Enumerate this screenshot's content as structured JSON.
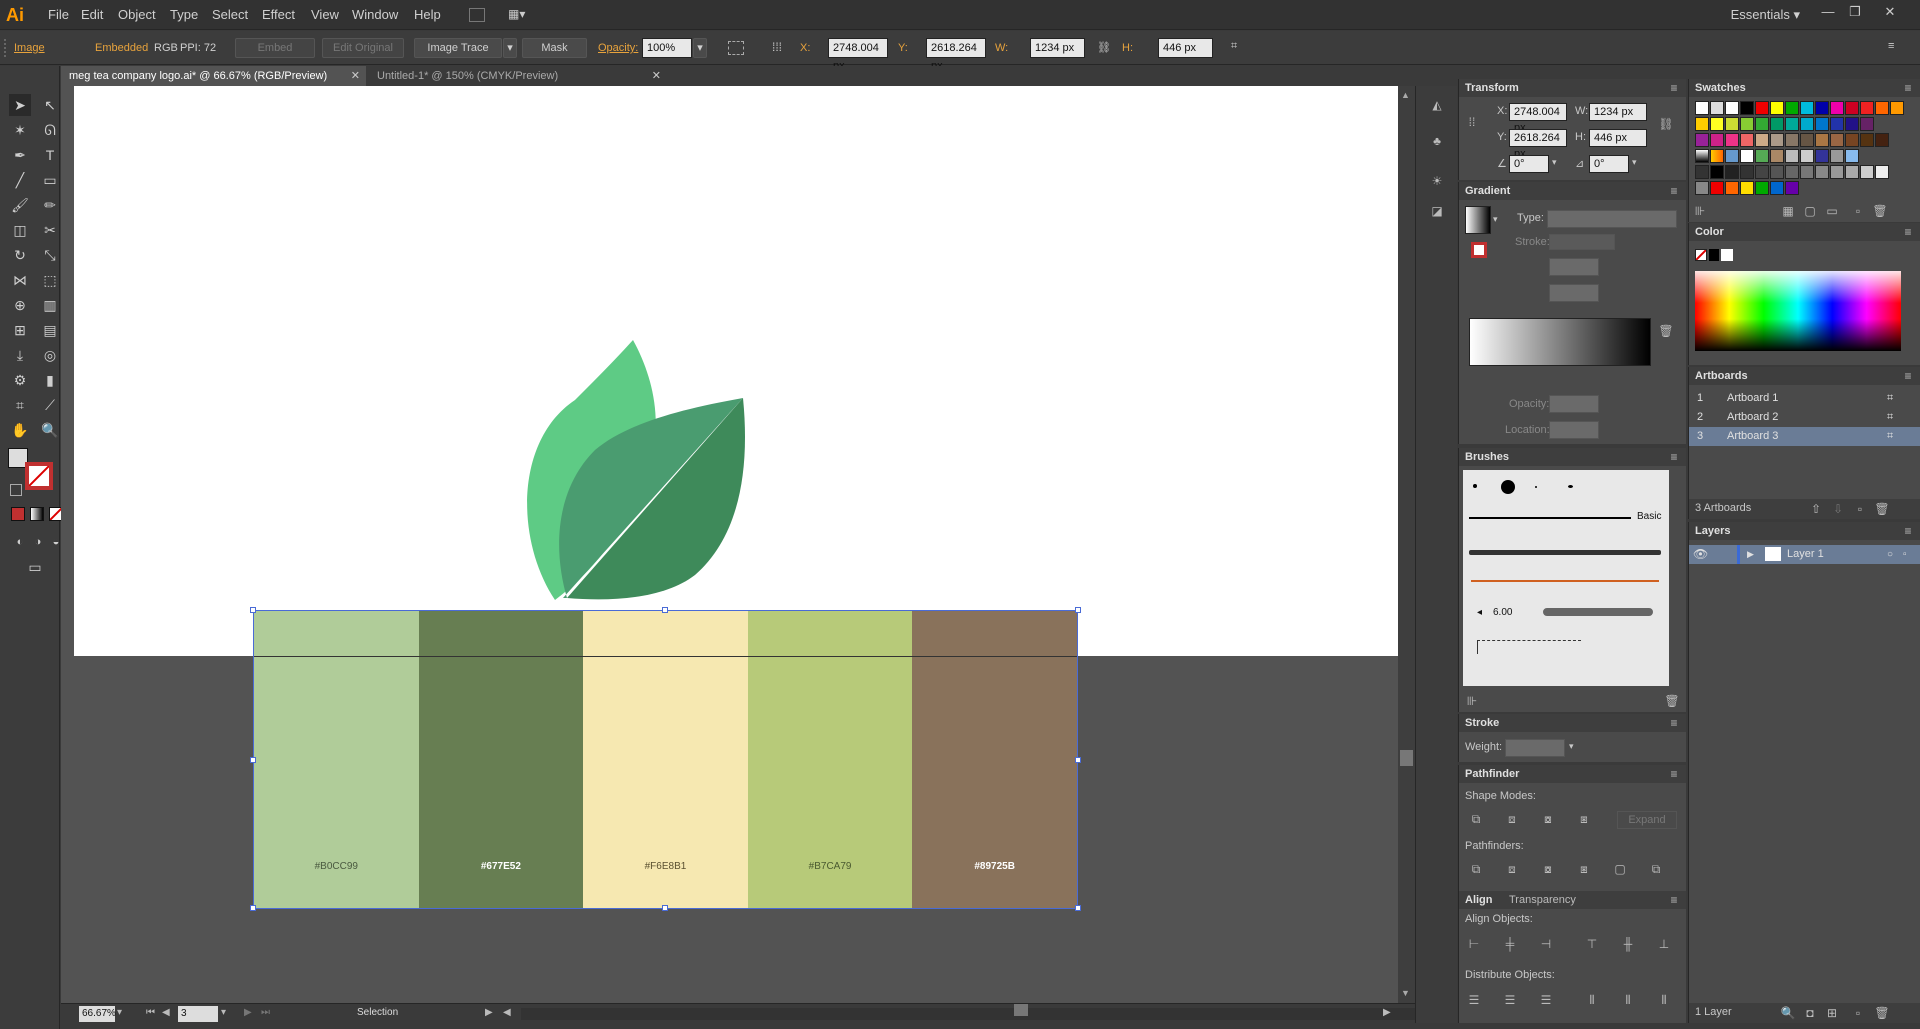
{
  "app": {
    "logo": "Ai",
    "workspace": "Essentials"
  },
  "menu": [
    "File",
    "Edit",
    "Object",
    "Type",
    "Select",
    "Effect",
    "View",
    "Window",
    "Help"
  ],
  "control": {
    "type_label": "Image",
    "embedded_label": "Embedded",
    "color_mode": "RGB",
    "ppi": "PPI: 72",
    "embed_btn": "Embed",
    "edit_original_btn": "Edit Original",
    "image_trace_btn": "Image Trace",
    "mask_btn": "Mask",
    "opacity_label": "Opacity:",
    "opacity_value": "100%",
    "x_label": "X:",
    "x_value": "2748.004 px",
    "y_label": "Y:",
    "y_value": "2618.264 px",
    "w_label": "W:",
    "w_value": "1234 px",
    "h_label": "H:",
    "h_value": "446 px"
  },
  "tabs": [
    {
      "label": "meg tea company logo.ai* @ 66.67% (RGB/Preview)"
    },
    {
      "label": "Untitled-1* @ 150% (CMYK/Preview)"
    }
  ],
  "palette": [
    {
      "hex": "#B0CC99",
      "color": "#B0CC99",
      "label": "#B0CC99",
      "text_color": "#4a5a40"
    },
    {
      "hex": "#677E52",
      "color": "#677E52",
      "label": "#677E52",
      "text_color": "#ffffff"
    },
    {
      "hex": "#F6E8B1",
      "color": "#F6E8B1",
      "label": "#F6E8B1",
      "text_color": "#5a5030"
    },
    {
      "hex": "#B7CA79",
      "color": "#B7CA79",
      "label": "#B7CA79",
      "text_color": "#4a5a30"
    },
    {
      "hex": "#89725B",
      "color": "#89725B",
      "label": "#89725B",
      "text_color": "#ffffff"
    }
  ],
  "leaf_colors": {
    "light": "#5ECB85",
    "mid": "#4A9C70",
    "dark": "#3E8A5A"
  },
  "status": {
    "zoom": "66.67%",
    "artboard_num": "3",
    "tool": "Selection"
  },
  "transform": {
    "title": "Transform",
    "x_label": "X:",
    "x_value": "2748.004 px",
    "y_label": "Y:",
    "y_value": "2618.264 px",
    "w_label": "W:",
    "w_value": "1234 px",
    "h_label": "H:",
    "h_value": "446 px",
    "angle_value": "0°",
    "shear_value": "0°"
  },
  "gradient": {
    "title": "Gradient",
    "type_label": "Type:",
    "stroke_label": "Stroke:",
    "opacity_label": "Opacity:",
    "location_label": "Location:"
  },
  "brushes": {
    "title": "Brushes",
    "basic_label": "Basic",
    "size_label": "6.00"
  },
  "stroke": {
    "title": "Stroke",
    "weight_label": "Weight:"
  },
  "pathfinder": {
    "title": "Pathfinder",
    "shape_modes_label": "Shape Modes:",
    "expand_btn": "Expand",
    "pathfinders_label": "Pathfinders:"
  },
  "align": {
    "title": "Align",
    "transparency_tab": "Transparency",
    "align_objects_label": "Align Objects:",
    "distribute_objects_label": "Distribute Objects:"
  },
  "swatches": {
    "title": "Swatches"
  },
  "color_panel": {
    "title": "Color"
  },
  "artboards": {
    "title": "Artboards",
    "items": [
      {
        "num": "1",
        "name": "Artboard 1"
      },
      {
        "num": "2",
        "name": "Artboard 2"
      },
      {
        "num": "3",
        "name": "Artboard 3"
      }
    ],
    "count_label": "3 Artboards"
  },
  "layers": {
    "title": "Layers",
    "items": [
      {
        "name": "Layer 1"
      }
    ],
    "count_label": "1 Layer"
  }
}
